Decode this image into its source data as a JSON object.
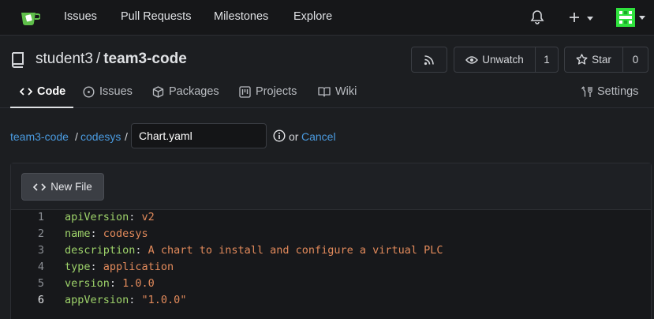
{
  "topnav": {
    "links": [
      "Issues",
      "Pull Requests",
      "Milestones",
      "Explore"
    ],
    "icons": {
      "logo": "tea-cup-logo",
      "notifications": "bell-icon",
      "create": "plus-icon",
      "avatar": "user-avatar"
    },
    "colors": {
      "avatar": "#2fe13d"
    }
  },
  "repo": {
    "owner": "student3",
    "separator": "/",
    "name": "team3-code",
    "rss_icon": "rss-icon",
    "unwatch_label": "Unwatch",
    "watch_count": "1",
    "star_label": "Star",
    "star_count": "0"
  },
  "tabs": [
    {
      "label": "Code",
      "icon": "code-icon",
      "active": true
    },
    {
      "label": "Issues",
      "icon": "issue-icon",
      "active": false
    },
    {
      "label": "Packages",
      "icon": "package-icon",
      "active": false
    },
    {
      "label": "Projects",
      "icon": "project-icon",
      "active": false
    },
    {
      "label": "Wiki",
      "icon": "book-icon",
      "active": false
    },
    {
      "label": "Settings",
      "icon": "tools-icon",
      "active": false
    }
  ],
  "breadcrumb": {
    "repo": "team3-code",
    "folder": "codesys",
    "separator": "/",
    "filename": "Chart.yaml",
    "or_text": "or",
    "cancel_label": "Cancel"
  },
  "editor": {
    "new_file_label": "New File",
    "current_line": 6,
    "lines": [
      {
        "number": "1",
        "key": "apiVersion",
        "value": "v2"
      },
      {
        "number": "2",
        "key": "name",
        "value": "codesys"
      },
      {
        "number": "3",
        "key": "description",
        "value": "A chart to install and configure a virtual PLC"
      },
      {
        "number": "4",
        "key": "type",
        "value": "application"
      },
      {
        "number": "5",
        "key": "version",
        "value": "1.0.0"
      },
      {
        "number": "6",
        "key": "appVersion",
        "value": "\"1.0.0\""
      }
    ]
  },
  "colors": {
    "background": "#1c1e21",
    "link": "#4a9be0",
    "yaml_key": "#9ed36a",
    "yaml_value": "#e28a5b"
  }
}
